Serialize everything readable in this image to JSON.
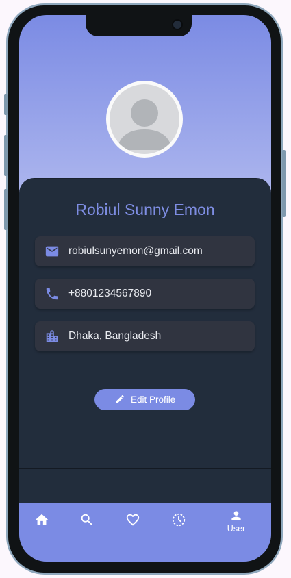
{
  "profile": {
    "name": "Robiul Sunny Emon",
    "email": "robiulsunyemon@gmail.com",
    "phone": "+8801234567890",
    "location": "Dhaka, Bangladesh",
    "edit_label": "Edit Profile"
  },
  "nav": {
    "items": [
      {
        "icon": "home-icon",
        "label": ""
      },
      {
        "icon": "search-icon",
        "label": ""
      },
      {
        "icon": "heart-icon",
        "label": ""
      },
      {
        "icon": "history-icon",
        "label": ""
      },
      {
        "icon": "user-icon",
        "label": "User"
      }
    ],
    "active_label": "User"
  },
  "colors": {
    "accent": "#7b8be4",
    "card_background": "#222d3c",
    "row_background": "#303440",
    "name_text": "#7e8de2",
    "avatar_placeholder": "#d8d9dc"
  }
}
